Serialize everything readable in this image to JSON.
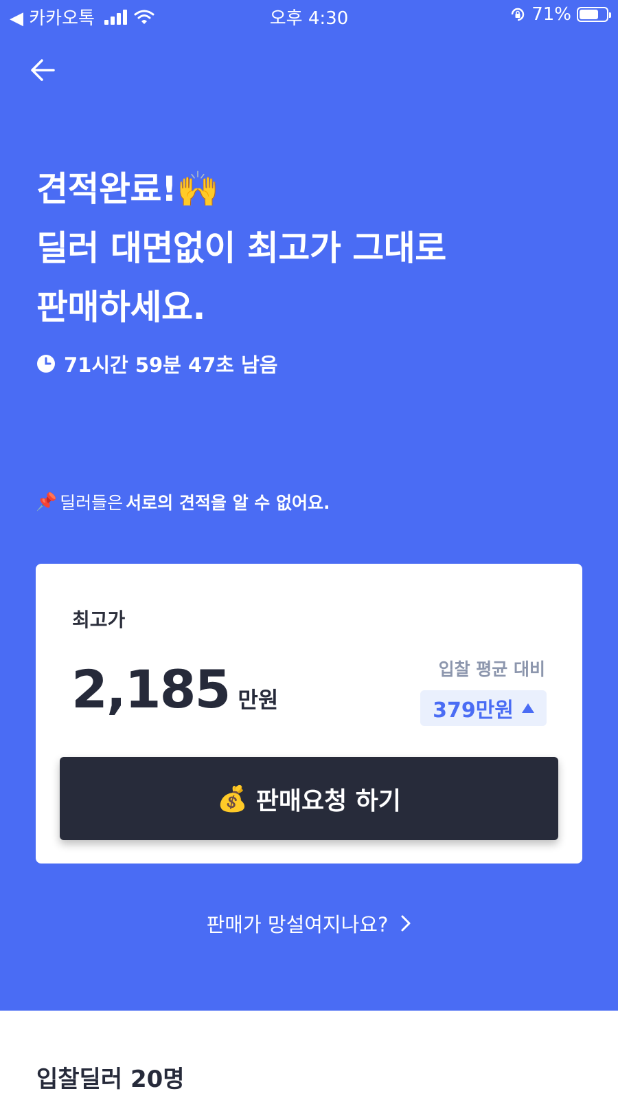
{
  "status_bar": {
    "back_app": "◀ 카카오톡",
    "time": "오후 4:30",
    "battery": "71%",
    "battery_level": 0.71
  },
  "headline": {
    "line1": "견적완료!🙌",
    "line2": "딜러 대면없이 최고가 그대로",
    "line3": "판매하세요."
  },
  "timer": {
    "remaining": "71시간 59분 47초 남음"
  },
  "notice": {
    "emoji": "📌",
    "prefix": "딜러들은",
    "emphasis": "서로의 견적을 알 수 없어요."
  },
  "price_card": {
    "label": "최고가",
    "price": "2,185",
    "unit": "만원",
    "compare_label": "입찰 평균 대비",
    "compare_value": "379만원",
    "sell_button_emoji": "💰",
    "sell_button_label": "판매요청 하기"
  },
  "help_link": {
    "label": "판매가 망설여지나요?"
  },
  "section": {
    "title": "입찰딜러 20명"
  },
  "colors": {
    "primary_blue": "#4a6cf4",
    "dark": "#272b3a",
    "badge_bg": "#eaf0fd"
  }
}
